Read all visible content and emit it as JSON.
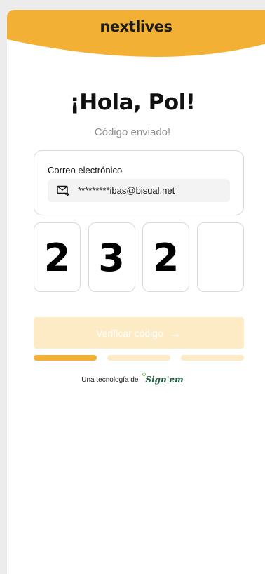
{
  "brand": {
    "name": "nextlives"
  },
  "greeting": "¡Hola, Pol!",
  "subtitle": "Código enviado!",
  "email": {
    "label": "Correo electrónico",
    "value": "*********ibas@bisual.net",
    "icon": "mail-arrow-icon"
  },
  "code": {
    "digits": [
      "2",
      "3",
      "2",
      ""
    ]
  },
  "verify_button": {
    "label": "Verificar código",
    "icon": "arrow-right-icon",
    "enabled": false
  },
  "progress": {
    "total_steps": 3,
    "current_step": 1
  },
  "footer": {
    "text": "Una tecnología de",
    "logo_text": "Sign'em"
  },
  "colors": {
    "accent": "#f2b134",
    "accent_light": "#fdebc6",
    "background": "#ececec",
    "signem_green": "#1f5e3a"
  }
}
